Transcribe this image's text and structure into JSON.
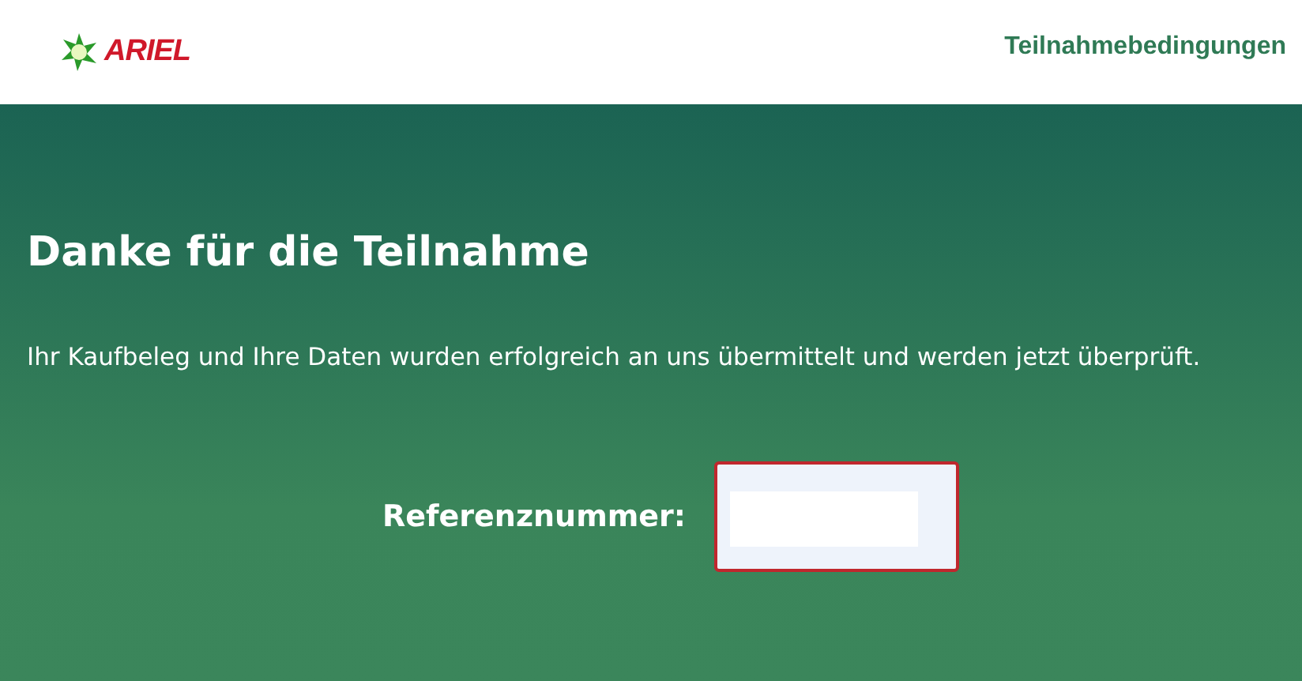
{
  "header": {
    "logo": "ARIEL",
    "link": "Teilnahmebedingungen"
  },
  "content": {
    "title": "Danke für die Teilnahme",
    "message": "Ihr Kaufbeleg und Ihre Daten wurden erfolgreich an uns übermittelt und werden jetzt überprüft.",
    "reference_label": "Referenznummer:"
  }
}
